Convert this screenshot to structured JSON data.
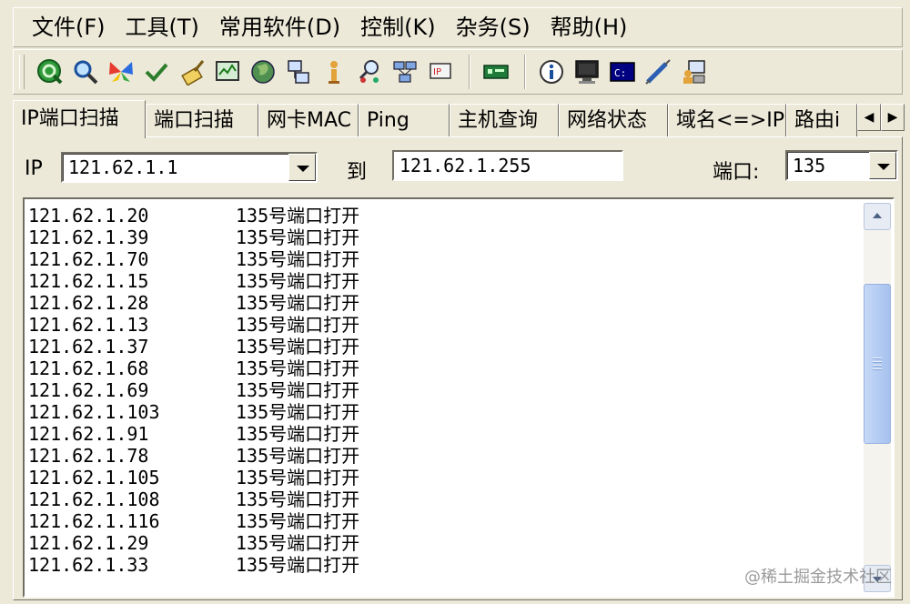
{
  "menu": [
    "文件(F)",
    "工具(T)",
    "常用软件(D)",
    "控制(K)",
    "杂务(S)",
    "帮助(H)"
  ],
  "toolbar": {
    "icons_group1": [
      "scan-globe-icon",
      "magnifier-icon",
      "butterfly-icon",
      "checkmark-icon",
      "broom-icon",
      "monitor-chart-icon",
      "globe-icon",
      "network-computer-icon",
      "info-person-icon",
      "search-users-icon",
      "network-hosts-icon",
      "network-card-icon"
    ],
    "icons_group2": [
      "green-board-icon"
    ],
    "icons_group3": [
      "info-circle-icon",
      "monitor-icon",
      "console-icon",
      "syringe-icon",
      "user-computer-icon"
    ]
  },
  "tabs": [
    "IP端口扫描",
    "端口扫描",
    "网卡MAC",
    "Ping",
    "主机查询",
    "网络状态",
    "域名<=>IP",
    "路由i"
  ],
  "form": {
    "ip_label": "IP",
    "ip_from": "121.62.1.1",
    "to_label": "到",
    "ip_to": "121.62.1.255",
    "port_label": "端口:",
    "port": "135"
  },
  "results": [
    {
      "ip": "121.62.1.20",
      "status": "135号端口打开"
    },
    {
      "ip": "121.62.1.39",
      "status": "135号端口打开"
    },
    {
      "ip": "121.62.1.70",
      "status": "135号端口打开"
    },
    {
      "ip": "121.62.1.15",
      "status": "135号端口打开"
    },
    {
      "ip": "121.62.1.28",
      "status": "135号端口打开"
    },
    {
      "ip": "121.62.1.13",
      "status": "135号端口打开"
    },
    {
      "ip": "121.62.1.37",
      "status": "135号端口打开"
    },
    {
      "ip": "121.62.1.68",
      "status": "135号端口打开"
    },
    {
      "ip": "121.62.1.69",
      "status": "135号端口打开"
    },
    {
      "ip": "121.62.1.103",
      "status": "135号端口打开"
    },
    {
      "ip": "121.62.1.91",
      "status": "135号端口打开"
    },
    {
      "ip": "121.62.1.78",
      "status": "135号端口打开"
    },
    {
      "ip": "121.62.1.105",
      "status": "135号端口打开"
    },
    {
      "ip": "121.62.1.108",
      "status": "135号端口打开"
    },
    {
      "ip": "121.62.1.116",
      "status": "135号端口打开"
    },
    {
      "ip": "121.62.1.29",
      "status": "135号端口打开"
    },
    {
      "ip": "121.62.1.33",
      "status": "135号端口打开"
    }
  ],
  "scrollbar": {
    "position": 0.3
  },
  "watermark": "@稀土掘金技术社区"
}
